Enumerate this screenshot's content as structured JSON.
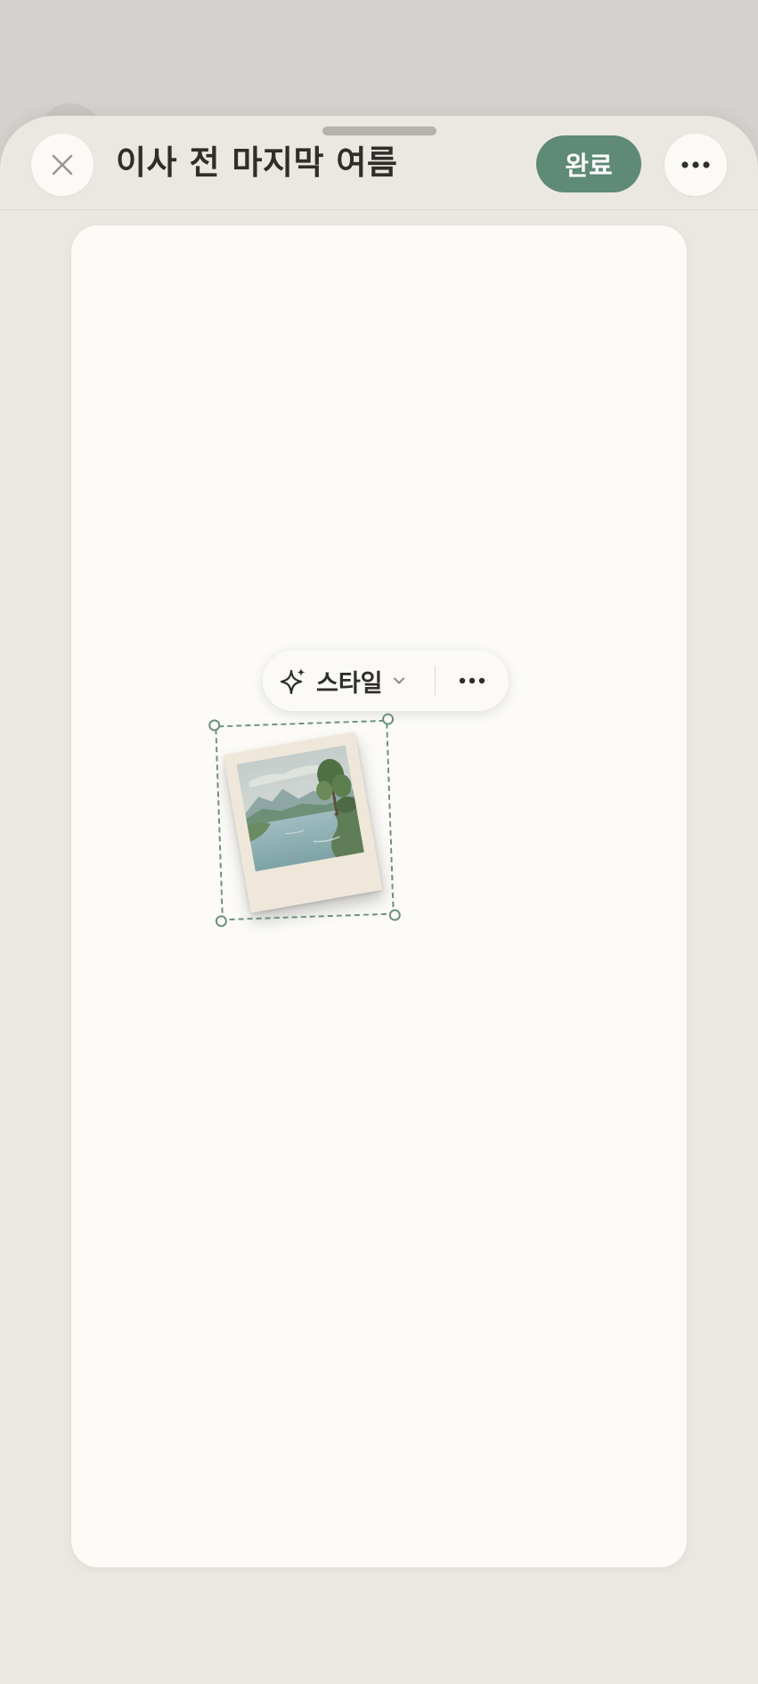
{
  "header": {
    "title": "이사 전 마지막 여름",
    "done_label": "완료"
  },
  "icons": {
    "close": "close-icon",
    "more": "more-icon",
    "style": "sparkles-icon",
    "chevron": "chevron-down-icon"
  },
  "element_toolbar": {
    "style_label": "스타일"
  },
  "colors": {
    "accent": "#5e8a77",
    "sheet_background": "#ebe8e1",
    "canvas_background": "#fcfbf8",
    "selection_border": "#6b8f80"
  }
}
